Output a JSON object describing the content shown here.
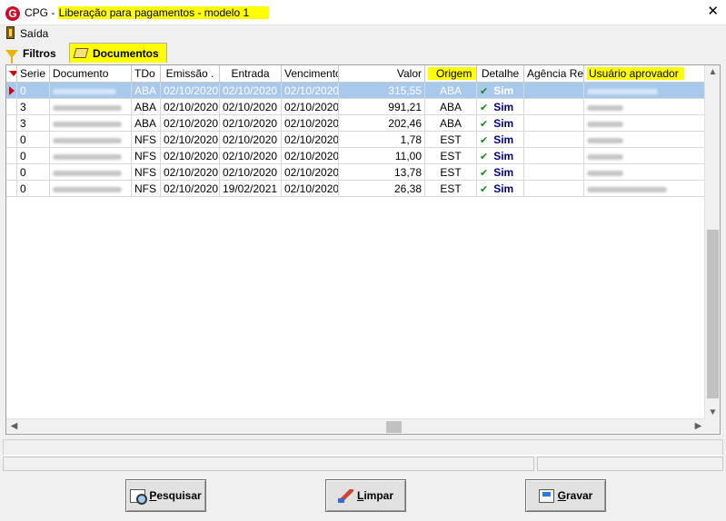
{
  "window": {
    "app_name": "CPG - ",
    "title": "Liberação para pagamentos - modelo 1",
    "close_glyph": "✕"
  },
  "menu": {
    "saida": "Saída"
  },
  "tabs": [
    {
      "label": "Filtros",
      "icon": "funnel-icon"
    },
    {
      "label": "Documentos",
      "icon": "document-pen-icon"
    }
  ],
  "grid": {
    "columns": [
      {
        "label": "Serie"
      },
      {
        "label": "Documento"
      },
      {
        "label": "TDo"
      },
      {
        "label": "Emissão ."
      },
      {
        "label": "Entrada"
      },
      {
        "label": "Vencimento"
      },
      {
        "label": "Valor"
      },
      {
        "label": "Origem"
      },
      {
        "label": "Detalhe"
      },
      {
        "label": "Agência Ret."
      },
      {
        "label": "Usuário aprovador"
      }
    ],
    "rows": [
      {
        "serie": "0",
        "tdo": "ABA",
        "emissao": "02/10/2020",
        "entrada": "02/10/2020",
        "vencimento": "02/10/2020",
        "valor": "315,55",
        "origem": "ABA",
        "detalhe": "Sim",
        "agencia": ""
      },
      {
        "serie": "3",
        "tdo": "ABA",
        "emissao": "02/10/2020",
        "entrada": "02/10/2020",
        "vencimento": "02/10/2020",
        "valor": "991,21",
        "origem": "ABA",
        "detalhe": "Sim",
        "agencia": ""
      },
      {
        "serie": "3",
        "tdo": "ABA",
        "emissao": "02/10/2020",
        "entrada": "02/10/2020",
        "vencimento": "02/10/2020",
        "valor": "202,46",
        "origem": "ABA",
        "detalhe": "Sim",
        "agencia": ""
      },
      {
        "serie": "0",
        "tdo": "NFS",
        "emissao": "02/10/2020",
        "entrada": "02/10/2020",
        "vencimento": "02/10/2020",
        "valor": "1,78",
        "origem": "EST",
        "detalhe": "Sim",
        "agencia": ""
      },
      {
        "serie": "0",
        "tdo": "NFS",
        "emissao": "02/10/2020",
        "entrada": "02/10/2020",
        "vencimento": "02/10/2020",
        "valor": "11,00",
        "origem": "EST",
        "detalhe": "Sim",
        "agencia": ""
      },
      {
        "serie": "0",
        "tdo": "NFS",
        "emissao": "02/10/2020",
        "entrada": "02/10/2020",
        "vencimento": "02/10/2020",
        "valor": "13,78",
        "origem": "EST",
        "detalhe": "Sim",
        "agencia": ""
      },
      {
        "serie": "0",
        "tdo": "NFS",
        "emissao": "02/10/2020",
        "entrada": "19/02/2021",
        "vencimento": "02/10/2020",
        "valor": "26,38",
        "origem": "EST",
        "detalhe": "Sim",
        "agencia": ""
      }
    ]
  },
  "buttons": {
    "pesquisar": {
      "accel": "P",
      "rest": "esquisar"
    },
    "limpar": {
      "accel": "L",
      "rest": "impar"
    },
    "gravar": {
      "accel": "G",
      "rest": "ravar"
    }
  },
  "colors": {
    "highlight": "#ffff00",
    "selected_row": "#a9c9ec",
    "check": "#1b8a1b",
    "sim": "#000080",
    "logo": "#c8102e"
  }
}
